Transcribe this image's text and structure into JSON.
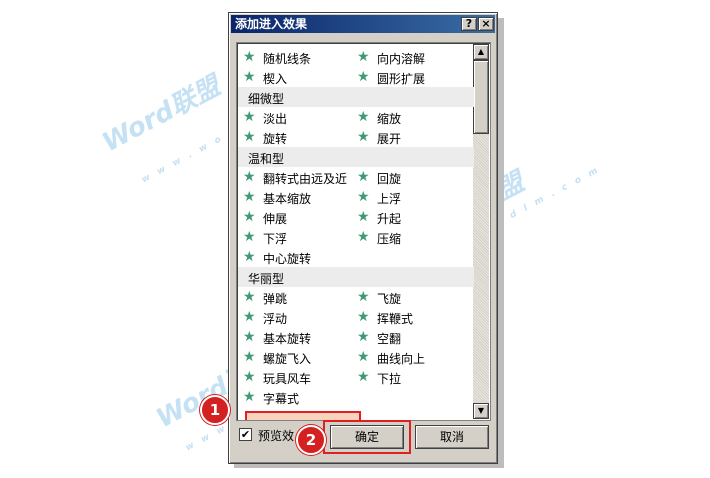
{
  "dialog": {
    "title": "添加进入效果",
    "help_button": "?",
    "close_button": "×"
  },
  "list": {
    "top_rows": [
      [
        "随机线条",
        "向内溶解"
      ],
      [
        "楔入",
        "圆形扩展"
      ]
    ],
    "groups": [
      {
        "name": "细微型",
        "rows": [
          [
            "淡出",
            "缩放"
          ],
          [
            "旋转",
            "展开"
          ]
        ]
      },
      {
        "name": "温和型",
        "rows": [
          [
            "翻转式由远及近",
            "回旋"
          ],
          [
            "基本缩放",
            "上浮"
          ],
          [
            "伸展",
            "升起"
          ],
          [
            "下浮",
            "压缩"
          ],
          [
            "中心旋转",
            ""
          ]
        ]
      },
      {
        "name": "华丽型",
        "rows": [
          [
            "弹跳",
            "飞旋"
          ],
          [
            "浮动",
            "挥鞭式"
          ],
          [
            "基本旋转",
            "空翻"
          ],
          [
            "螺旋飞入",
            "曲线向上"
          ],
          [
            "玩具风车",
            "下拉"
          ],
          [
            "字幕式",
            ""
          ]
        ]
      }
    ],
    "selected": "字幕式"
  },
  "preview_checkbox": {
    "label": "预览效",
    "checked": true,
    "mark": "✔"
  },
  "buttons": {
    "ok": "确定",
    "cancel": "取消"
  },
  "annotations": {
    "badge1": "1",
    "badge2": "2"
  },
  "watermark": {
    "big": "Word联盟",
    "small": "w w w . w o r d l m . c o m"
  },
  "colors": {
    "star": "#3f9a74",
    "highlight": "#e02020",
    "title_bar": "#0a246a"
  }
}
